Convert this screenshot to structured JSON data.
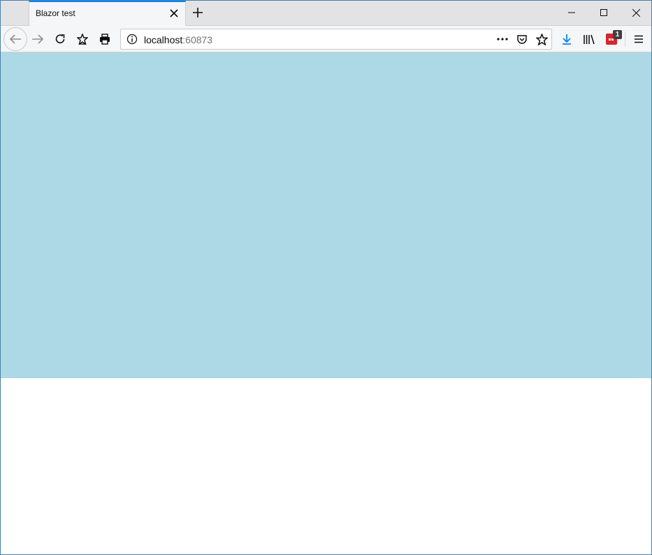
{
  "tab": {
    "title": "Blazor test"
  },
  "urlbar": {
    "host": "localhost",
    "port": ":60873"
  },
  "extension": {
    "badge": "1"
  },
  "icons": {
    "close_tab": "close-icon",
    "new_tab": "plus-icon",
    "minimize": "minimize-icon",
    "maximize": "maximize-icon",
    "close_window": "close-icon",
    "back": "arrow-left-icon",
    "forward": "arrow-right-icon",
    "reload": "reload-icon",
    "bookmarks": "star-bookmark-icon",
    "print": "printer-icon",
    "site_info": "info-icon",
    "page_actions": "more-horizontal-icon",
    "pocket": "pocket-icon",
    "bookmark_star": "star-icon",
    "downloads": "download-arrow-icon",
    "library": "library-icon",
    "extension": "extension-icon",
    "menu": "hamburger-menu-icon"
  },
  "colors": {
    "content_div": "#add8e6",
    "page_background": "#ffffff",
    "active_tab_accent": "#0a84ff",
    "download_icon": "#0a84ff"
  }
}
